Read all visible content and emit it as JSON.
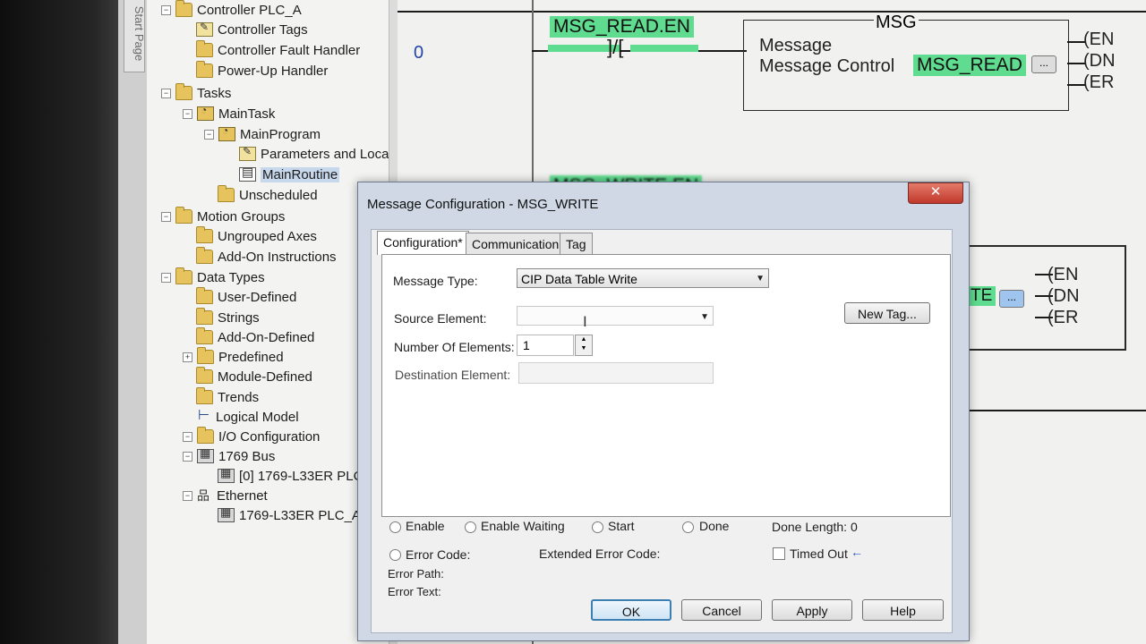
{
  "tree": {
    "items": [
      {
        "label": "Controller PLC_A",
        "icon": "folder-icon",
        "expander": "−"
      },
      {
        "label": "Controller Tags",
        "icon": "tag-icon"
      },
      {
        "label": "Controller Fault Handler",
        "icon": "folder-icon"
      },
      {
        "label": "Power-Up Handler",
        "icon": "folder-icon"
      },
      {
        "label": "Tasks",
        "icon": "folder-icon",
        "expander": "−"
      },
      {
        "label": "MainTask",
        "icon": "task-icon",
        "expander": "−"
      },
      {
        "label": "MainProgram",
        "icon": "task-icon",
        "expander": "−"
      },
      {
        "label": "Parameters and Loca",
        "icon": "tag-icon"
      },
      {
        "label": "MainRoutine",
        "icon": "routine-icon"
      },
      {
        "label": "Unscheduled",
        "icon": "folder-icon"
      },
      {
        "label": "Motion Groups",
        "icon": "folder-icon",
        "expander": "−"
      },
      {
        "label": "Ungrouped Axes",
        "icon": "folder-icon"
      },
      {
        "label": "Add-On Instructions",
        "icon": "folder-icon"
      },
      {
        "label": "Data Types",
        "icon": "folder-icon",
        "expander": "−"
      },
      {
        "label": "User-Defined",
        "icon": "folder-icon"
      },
      {
        "label": "Strings",
        "icon": "folder-icon"
      },
      {
        "label": "Add-On-Defined",
        "icon": "folder-icon"
      },
      {
        "label": "Predefined",
        "icon": "folder-icon",
        "expander": "+"
      },
      {
        "label": "Module-Defined",
        "icon": "folder-icon"
      },
      {
        "label": "Trends",
        "icon": "folder-icon"
      },
      {
        "label": "Logical Model",
        "icon": "model-icon"
      },
      {
        "label": "I/O Configuration",
        "icon": "folder-icon",
        "expander": "−"
      },
      {
        "label": "1769 Bus",
        "icon": "module-icon",
        "expander": "−"
      },
      {
        "label": "[0] 1769-L33ER PLC",
        "icon": "module-icon"
      },
      {
        "label": "Ethernet",
        "icon": "net-icon",
        "expander": "−"
      },
      {
        "label": "1769-L33ER PLC_A",
        "icon": "module-icon"
      }
    ],
    "selected": "MainRoutine"
  },
  "side_tab": {
    "label": "Start Page"
  },
  "ladder": {
    "rung0_number": "0",
    "contact_tag": "MSG_READ.EN",
    "contact_symbol": "]/[",
    "instruction_name": "MSG",
    "instruction_row1": "Message",
    "instruction_row2_label": "Message Control",
    "instruction_row2_tag": "MSG_READ",
    "ellipsis": "...",
    "outputs": [
      "EN",
      "DN",
      "ER"
    ],
    "contact2_tag": "MSG_WRITE.EN",
    "rung1_tag_fragment": "TE"
  },
  "dialog": {
    "title": "Message Configuration - MSG_WRITE",
    "close_symbol": "✕",
    "tabs": [
      "Configuration*",
      "Communication",
      "Tag"
    ],
    "message_type_label": "Message Type:",
    "message_type_value": "CIP Data Table Write",
    "source_element_label": "Source Element:",
    "source_element_value": "",
    "num_elements_label": "Number Of Elements:",
    "num_elements_value": "1",
    "dest_element_label": "Destination Element:",
    "dest_element_value": "",
    "new_tag_button": "New Tag...",
    "status": {
      "enable": "Enable",
      "enable_waiting": "Enable Waiting",
      "start": "Start",
      "done": "Done",
      "done_length_label": "Done Length:",
      "done_length_value": "0",
      "error_code": "Error Code:",
      "extended_error_code": "Extended Error Code:",
      "timed_out": "Timed Out",
      "timed_out_arrow": "←",
      "error_path": "Error Path:",
      "error_text": "Error Text:"
    },
    "buttons": {
      "ok": "OK",
      "cancel": "Cancel",
      "apply": "Apply",
      "help": "Help"
    }
  }
}
